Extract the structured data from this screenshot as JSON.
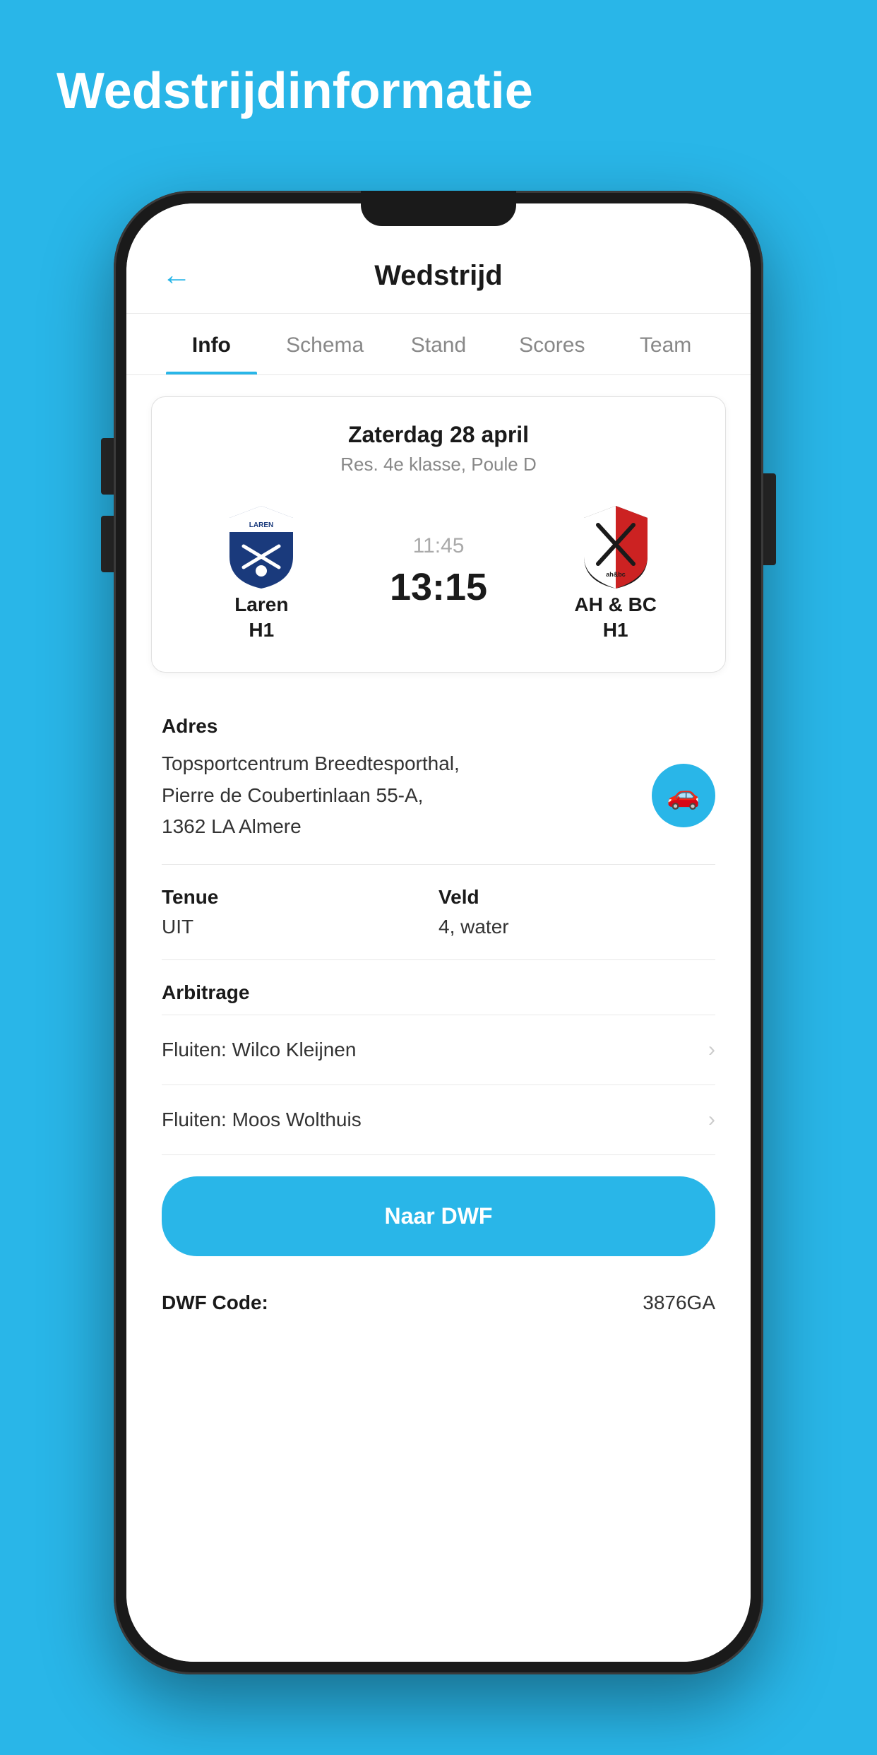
{
  "page": {
    "background_title": "Wedstrijdinformatie",
    "header": {
      "back_label": "←",
      "title": "Wedstrijd"
    },
    "tabs": [
      {
        "id": "info",
        "label": "Info",
        "active": true
      },
      {
        "id": "schema",
        "label": "Schema",
        "active": false
      },
      {
        "id": "stand",
        "label": "Stand",
        "active": false
      },
      {
        "id": "scores",
        "label": "Scores",
        "active": false
      },
      {
        "id": "team",
        "label": "Team",
        "active": false
      }
    ],
    "match": {
      "date": "Zaterdag 28 april",
      "competition": "Res. 4e klasse, Poule D",
      "home_team": {
        "name": "Laren",
        "sub": "H1"
      },
      "away_team": {
        "name": "AH & BC",
        "sub": "H1"
      },
      "time": "11:45",
      "score": "13:15"
    },
    "address": {
      "label": "Adres",
      "value": "Topsportcentrum Breedtesporthal,\nPierre de Coubertinlaan 55-A,\n1362 LA Almere"
    },
    "tenue": {
      "label": "Tenue",
      "value": "UIT"
    },
    "veld": {
      "label": "Veld",
      "value": "4, water"
    },
    "arbitrage": {
      "label": "Arbitrage",
      "items": [
        {
          "text": "Fluiten: Wilco Kleijnen"
        },
        {
          "text": "Fluiten: Moos Wolthuis"
        }
      ]
    },
    "naar_dwf": {
      "label": "Naar DWF"
    },
    "dwf_code": {
      "label": "DWF Code:",
      "value": "3876GA"
    }
  },
  "colors": {
    "accent": "#29b6e8",
    "text_dark": "#1a1a1a",
    "text_gray": "#888888",
    "divider": "#e8e8e8"
  }
}
